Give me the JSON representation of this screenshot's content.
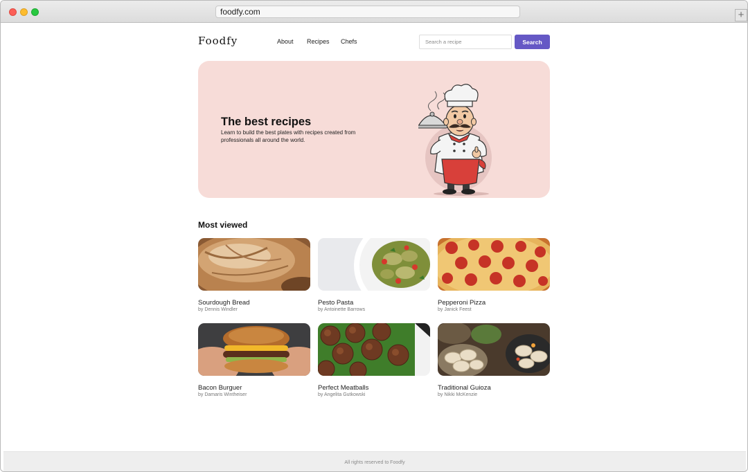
{
  "browser": {
    "url": "foodfy.com",
    "new_tab_symbol": "+"
  },
  "header": {
    "logo": "Foodfy",
    "nav": [
      {
        "label": "About"
      },
      {
        "label": "Recipes"
      },
      {
        "label": "Chefs"
      }
    ],
    "search": {
      "placeholder": "Search a recipe",
      "value": "",
      "button_label": "Search"
    }
  },
  "hero": {
    "title": "The best recipes",
    "subtitle": "Learn to build the best plates with recipes created from professionals all around the world.",
    "illustration": "chef-holding-cloche"
  },
  "most_viewed": {
    "title": "Most viewed",
    "recipes": [
      {
        "name": "Sourdough Bread",
        "author": "by Dennis Windler",
        "image": "bread-photo"
      },
      {
        "name": "Pesto Pasta",
        "author": "by Antoinette Barrows",
        "image": "pasta-photo"
      },
      {
        "name": "Pepperoni Pizza",
        "author": "by Janick Feest",
        "image": "pizza-photo"
      },
      {
        "name": "Bacon Burguer",
        "author": "by Damaris Wintheiser",
        "image": "burger-photo"
      },
      {
        "name": "Perfect Meatballs",
        "author": "by Angelita Gutkowski",
        "image": "meatballs-photo"
      },
      {
        "name": "Traditional Guioza",
        "author": "by Nikki McKenzie",
        "image": "gyoza-photo"
      }
    ]
  },
  "footer": {
    "text": "All rights reserved to Foodfy"
  },
  "colors": {
    "accent": "#6558c5",
    "hero_bg": "#f7dcd8",
    "footer_bg": "#eeeeee"
  }
}
